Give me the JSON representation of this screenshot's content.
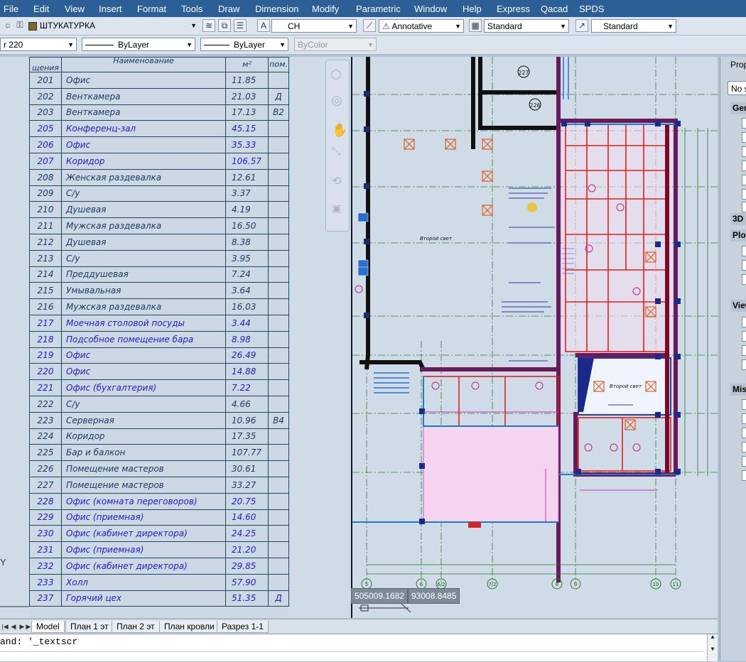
{
  "menu": [
    "File",
    "Edit",
    "View",
    "Insert",
    "Format",
    "Tools",
    "Draw",
    "Dimension",
    "Modify",
    "Parametric",
    "Window",
    "Help",
    "Express",
    "Qacad",
    "SPDS"
  ],
  "toolbar1": {
    "layer": "ШТУКАТУРКА",
    "text_style": "CH",
    "annotative": "Annotative",
    "dim_style": "Standard",
    "table_style": "Standard"
  },
  "toolbar2": {
    "layer_partial": "r 220",
    "linetype": "ByLayer",
    "lineweight": "ByLayer",
    "plotstyle": "ByColor"
  },
  "schedule": {
    "header": {
      "number": "щения",
      "number_top": "пом",
      "name": "Наименование",
      "area": "м²",
      "type": "пом."
    },
    "rows": [
      {
        "no": "201",
        "name": "Офис",
        "area": "11.85",
        "type": "",
        "blue": false
      },
      {
        "no": "202",
        "name": "Венткамера",
        "area": "21.03",
        "type": "Д",
        "blue": false
      },
      {
        "no": "203",
        "name": "Венткамера",
        "area": "17.13",
        "type": "В2",
        "blue": false
      },
      {
        "no": "205",
        "name": "Конференц-зал",
        "area": "45.15",
        "type": "",
        "blue": true
      },
      {
        "no": "206",
        "name": "Офис",
        "area": "35.33",
        "type": "",
        "blue": true
      },
      {
        "no": "207",
        "name": "Коридор",
        "area": "106.57",
        "type": "",
        "blue": true
      },
      {
        "no": "208",
        "name": "Женская раздевалка",
        "area": "12.61",
        "type": "",
        "blue": false
      },
      {
        "no": "209",
        "name": "С/у",
        "area": "3.37",
        "type": "",
        "blue": false
      },
      {
        "no": "210",
        "name": "Душевая",
        "area": "4.19",
        "type": "",
        "blue": false
      },
      {
        "no": "211",
        "name": "Мужская раздевалка",
        "area": "16.50",
        "type": "",
        "blue": false
      },
      {
        "no": "212",
        "name": "Душевая",
        "area": "8.38",
        "type": "",
        "blue": false
      },
      {
        "no": "213",
        "name": "С/у",
        "area": "3.95",
        "type": "",
        "blue": false
      },
      {
        "no": "214",
        "name": "Преддушевая",
        "area": "7.24",
        "type": "",
        "blue": false
      },
      {
        "no": "215",
        "name": "Умывальная",
        "area": "3.64",
        "type": "",
        "blue": false
      },
      {
        "no": "216",
        "name": "Мужская раздевалка",
        "area": "16.03",
        "type": "",
        "blue": false
      },
      {
        "no": "217",
        "name": "Моечная столовой посуды",
        "area": "3.44",
        "type": "",
        "blue": true
      },
      {
        "no": "218",
        "name": "Подсобное помещение бара",
        "area": "8.98",
        "type": "",
        "blue": true
      },
      {
        "no": "219",
        "name": "Офис",
        "area": "26.49",
        "type": "",
        "blue": true
      },
      {
        "no": "220",
        "name": "Офис",
        "area": "14.88",
        "type": "",
        "blue": true
      },
      {
        "no": "221",
        "name": "Офис (бухгалтерия)",
        "area": "7.22",
        "type": "",
        "blue": true
      },
      {
        "no": "222",
        "name": "С/у",
        "area": "4.66",
        "type": "",
        "blue": false
      },
      {
        "no": "223",
        "name": "Серверная",
        "area": "10.96",
        "type": "В4",
        "blue": false
      },
      {
        "no": "224",
        "name": "Коридор",
        "area": "17.35",
        "type": "",
        "blue": false
      },
      {
        "no": "225",
        "name": "Бар и балкон",
        "area": "107.77",
        "type": "",
        "blue": false
      },
      {
        "no": "226",
        "name": "Помещение мастеров",
        "area": "30.61",
        "type": "",
        "blue": false
      },
      {
        "no": "227",
        "name": "Помещение мастеров",
        "area": "33.27",
        "type": "",
        "blue": false
      },
      {
        "no": "228",
        "name": "Офис (комната переговоров)",
        "area": "20.75",
        "type": "",
        "blue": true
      },
      {
        "no": "229",
        "name": "Офис (приемная)",
        "area": "14.60",
        "type": "",
        "blue": true
      },
      {
        "no": "230",
        "name": "Офис (кабинет директора)",
        "area": "24.25",
        "type": "",
        "blue": true
      },
      {
        "no": "231",
        "name": "Офис (приемная)",
        "area": "21.20",
        "type": "",
        "blue": true
      },
      {
        "no": "232",
        "name": "Офис (кабинет директора)",
        "area": "29.85",
        "type": "",
        "blue": true
      },
      {
        "no": "233",
        "name": "Холл",
        "area": "57.90",
        "type": "",
        "blue": true
      },
      {
        "no": "237",
        "name": "Горячий цех",
        "area": "51.35",
        "type": "Д",
        "blue": true
      }
    ]
  },
  "plan": {
    "label_void": "Второй свет",
    "label_void2": "Второй свет",
    "bubble_top_1": "227",
    "bubble_top_2": "226",
    "axis_labels": [
      "5",
      "6",
      "6/2",
      "7/2",
      "8",
      "9",
      "10",
      "11"
    ]
  },
  "coords": {
    "x": "505009.1682",
    "y": "93008.8485"
  },
  "tabs": [
    "Model",
    "План 1 эт",
    "План 2 эт",
    "План кровли",
    "Разрез 1-1"
  ],
  "active_tab": "Model",
  "command": "and: '_textscr",
  "properties": {
    "title": "Prop",
    "selection": "No s",
    "sections": [
      "Gen",
      "3D",
      "Plot",
      "View",
      "Mis"
    ]
  },
  "ucs_label": "Y",
  "colors": {
    "menubar": "#2c5f95",
    "canvas": "#cfdbe6",
    "table_text": "#1d3a66",
    "blue_text": "#2020c8",
    "red_lines": "#e02020",
    "purple_walls": "#6a1a5a"
  }
}
